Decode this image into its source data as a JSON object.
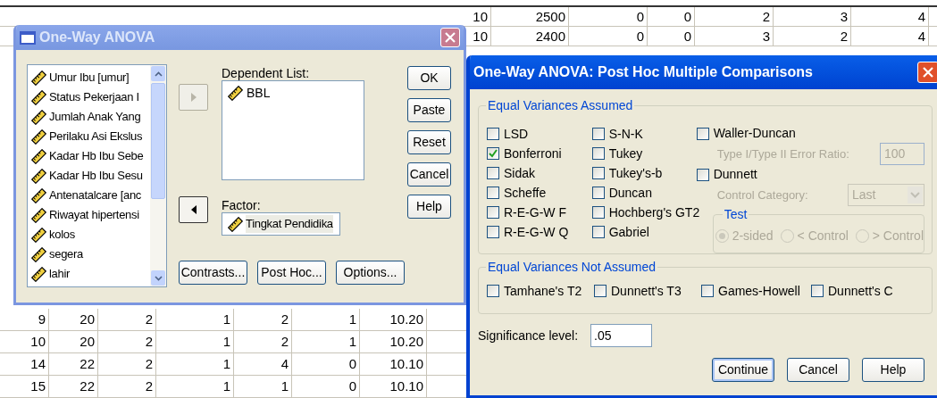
{
  "spreadsheet": {
    "upper_rows": [
      [
        "10",
        "2500",
        "0",
        "0",
        "2",
        "3",
        "4"
      ],
      [
        "10",
        "2400",
        "0",
        "0",
        "3",
        "2",
        "4"
      ]
    ],
    "lower_rows": [
      [
        "9",
        "20",
        "2",
        "1",
        "2",
        "1",
        "10.20"
      ],
      [
        "10",
        "20",
        "2",
        "1",
        "2",
        "1",
        "10.20"
      ],
      [
        "14",
        "22",
        "2",
        "1",
        "4",
        "0",
        "10.10"
      ],
      [
        "15",
        "22",
        "2",
        "1",
        "1",
        "0",
        "10.10"
      ]
    ]
  },
  "anova_dialog": {
    "title": "One-Way ANOVA",
    "active": false,
    "variables": [
      "Umur Ibu [umur]",
      "Status Pekerjaan I",
      "Jumlah Anak Yang",
      "Perilaku Asi Ekslus",
      "Kadar Hb Ibu Sebe",
      "Kadar Hb Ibu Sesu",
      "Antenatalcare [anc",
      "Riwayat hipertensi",
      "kolos",
      "segera",
      "lahir"
    ],
    "move_buttons": [
      {
        "kind": "right",
        "disabled": true
      },
      {
        "kind": "left",
        "disabled": false
      }
    ],
    "dependent_label": "Dependent List:",
    "dependent_list": [
      "BBL"
    ],
    "factor_label": "Factor:",
    "factor": "Tingkat Pendidika",
    "side_buttons": [
      "OK",
      "Paste",
      "Reset",
      "Cancel",
      "Help"
    ],
    "bottom_buttons": [
      "Contrasts...",
      "Post Hoc...",
      "Options..."
    ]
  },
  "post_hoc_dialog": {
    "title": "One-Way ANOVA: Post Hoc Multiple Comparisons",
    "active": true,
    "assumed_group": {
      "label": "Equal Variances Assumed",
      "columns": [
        [
          {
            "label": "LSD",
            "checked": false
          },
          {
            "label": "Bonferroni",
            "checked": true
          },
          {
            "label": "Sidak",
            "checked": false
          },
          {
            "label": "Scheffe",
            "checked": false
          },
          {
            "label": "R-E-G-W F",
            "checked": false
          },
          {
            "label": "R-E-G-W Q",
            "checked": false
          }
        ],
        [
          {
            "label": "S-N-K",
            "checked": false
          },
          {
            "label": "Tukey",
            "checked": false
          },
          {
            "label": "Tukey's-b",
            "checked": false
          },
          {
            "label": "Duncan",
            "checked": false
          },
          {
            "label": "Hochberg's GT2",
            "checked": false
          },
          {
            "label": "Gabriel",
            "checked": false
          }
        ]
      ],
      "waller_duncan": {
        "label": "Waller-Duncan",
        "checked": false
      },
      "error_ratio": {
        "label": "Type I/Type II Error Ratio:",
        "value": "100",
        "disabled": true
      },
      "dunnett": {
        "label": "Dunnett",
        "checked": false
      },
      "control_category": {
        "label": "Control Category:",
        "value": "Last",
        "disabled": true
      },
      "test": {
        "label": "Test",
        "disabled": true,
        "options": [
          {
            "label": "2-sided",
            "selected": true
          },
          {
            "label": "< Control",
            "selected": false
          },
          {
            "label": "> Control",
            "selected": false
          }
        ]
      }
    },
    "not_assumed_group": {
      "label": "Equal Variances Not Assumed",
      "options": [
        {
          "label": "Tamhane's T2",
          "checked": false
        },
        {
          "label": "Dunnett's T3",
          "checked": false
        },
        {
          "label": "Games-Howell",
          "checked": false
        },
        {
          "label": "Dunnett's C",
          "checked": false
        }
      ]
    },
    "significance_label": "Significance level:",
    "significance_value": ".05",
    "buttons": [
      {
        "label": "Continue",
        "default": true
      },
      {
        "label": "Cancel",
        "default": false
      },
      {
        "label": "Help",
        "default": false
      }
    ]
  }
}
